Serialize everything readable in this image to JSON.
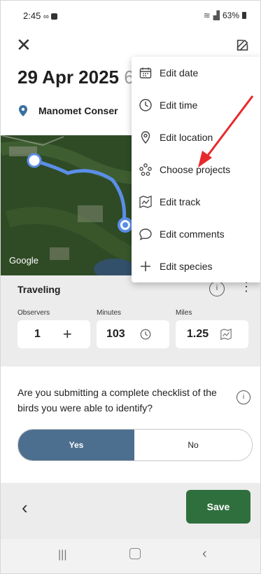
{
  "status": {
    "time": "2:45",
    "battery": "63%"
  },
  "header": {
    "date_title": "29 Apr 2025",
    "date_suffix": "6"
  },
  "location": {
    "name": "Manomet Conser"
  },
  "map": {
    "attribution": "Google"
  },
  "protocol": {
    "name": "Traveling",
    "fields": [
      {
        "label": "Observers",
        "value": "1"
      },
      {
        "label": "Minutes",
        "value": "103"
      },
      {
        "label": "Miles",
        "value": "1.25"
      }
    ]
  },
  "question": {
    "text": "Are you submitting a complete checklist of the birds you were able to identify?",
    "yes_label": "Yes",
    "no_label": "No",
    "selected": "Yes"
  },
  "footer": {
    "save_label": "Save"
  },
  "menu": {
    "items": [
      {
        "label": "Edit date",
        "icon": "calendar-icon"
      },
      {
        "label": "Edit time",
        "icon": "clock-icon"
      },
      {
        "label": "Edit location",
        "icon": "location-pin-icon"
      },
      {
        "label": "Choose projects",
        "icon": "projects-icon"
      },
      {
        "label": "Edit track",
        "icon": "map-track-icon"
      },
      {
        "label": "Edit comments",
        "icon": "comment-icon"
      },
      {
        "label": "Edit species",
        "icon": "plus-icon"
      }
    ]
  },
  "colors": {
    "accent_blue": "#4d6f8f",
    "save_green": "#2f6f3e",
    "track_blue": "#5b8ee8",
    "annotation_red": "#e8292b"
  }
}
